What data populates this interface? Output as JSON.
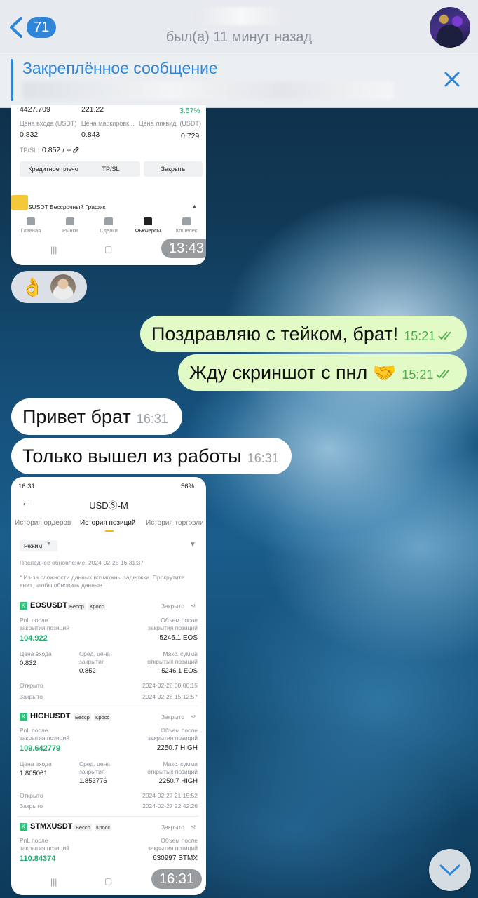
{
  "header": {
    "unread_count": "71",
    "contact_name": "",
    "status": "был(а) 11 минут назад"
  },
  "pinned": {
    "title": "Закреплённое сообщение",
    "text": ""
  },
  "shot1": {
    "top_val1": "4427.709",
    "top_val2": "221.22",
    "top_pct": "3.57%",
    "entry_label": "Цена входа (USDT)",
    "entry_val": "0.832",
    "mark_label": "Цена маркировк...",
    "mark_val": "0.843",
    "liq_label": "Цена ликвид. (USDT)",
    "liq_val": "0.729",
    "tpsl_label": "TP/SL:",
    "tpsl_val": "0.852 / --",
    "btn_leverage": "Кредитное плечо",
    "btn_tpsl": "TP/SL",
    "btn_close": "Закрыть",
    "pair_row": "SUSDT Бессрочный  График",
    "nav": [
      "Главная",
      "Рынки",
      "Сделки",
      "Фьючерсы",
      "Кошелек"
    ],
    "time": "13:43"
  },
  "reaction": {
    "emoji": "👌"
  },
  "messages": [
    {
      "text": "Поздравляю с тейком, брат!",
      "time": "15:21"
    },
    {
      "text": "Жду скриншот с пнл 🤝",
      "time": "15:21"
    },
    {
      "text": "Привет брат",
      "time": "16:31"
    },
    {
      "text": "Только вышел из работы",
      "time": "16:31"
    }
  ],
  "shot2": {
    "status_time": "16:31",
    "battery": "56%",
    "title": "USDⓈ-M",
    "tabs": [
      "История ордеров",
      "История позиций",
      "История торговли"
    ],
    "mode": "Режим",
    "updated": "Последнее обновление: 2024-02-28 16:31:37",
    "note": "* Из-за сложности данных возможны задержки. Прокрутите вниз, чтобы обновить данные.",
    "closed": "Закрыто",
    "perp": "Бесср",
    "cross": "Кросс",
    "pnl_label_1": "PnL после",
    "pnl_label_2": "закрытия позиций",
    "vol_label_1": "Объем после",
    "vol_label_2": "закрытия позиций",
    "entry_label": "Цена входа",
    "avg_label_1": "Сред. цена",
    "avg_label_2": "закрытия",
    "max_label_1": "Макс. сумма",
    "max_label_2": "открытых позиций",
    "opened_label": "Открыто",
    "closed_label": "Закрыто",
    "positions": [
      {
        "symbol": "EOSUSDT",
        "pnl": "104.922",
        "volume": "5246.1 EOS",
        "entry": "0.832",
        "avg_close": "0.852",
        "max_open": "5246.1 EOS",
        "opened": "2024-02-28 00:00:15",
        "closed": "2024-02-28 15:12:57"
      },
      {
        "symbol": "HIGHUSDT",
        "pnl": "109.642779",
        "volume": "2250.7 HIGH",
        "entry": "1.805061",
        "avg_close": "1.853776",
        "max_open": "2250.7 HIGH",
        "opened": "2024-02-27 21:15:52",
        "closed": "2024-02-27 22:42:26"
      },
      {
        "symbol": "STMXUSDT",
        "pnl": "110.84374",
        "volume": "630997 STMX"
      }
    ],
    "time": "16:31"
  }
}
